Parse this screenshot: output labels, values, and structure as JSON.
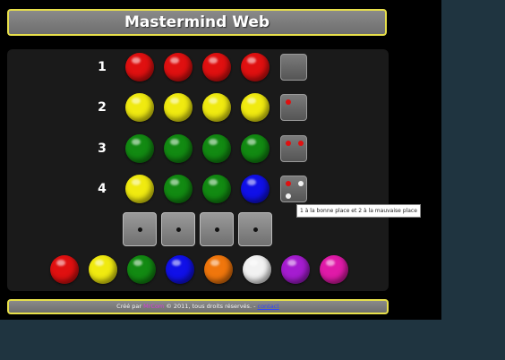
{
  "header": {
    "title": "Mastermind Web"
  },
  "rows": [
    {
      "number": "1",
      "pegs": [
        "red",
        "red",
        "red",
        "red"
      ],
      "feedback": []
    },
    {
      "number": "2",
      "pegs": [
        "yellow",
        "yellow",
        "yellow",
        "yellow"
      ],
      "feedback": [
        "red"
      ]
    },
    {
      "number": "3",
      "pegs": [
        "green",
        "green",
        "green",
        "green"
      ],
      "feedback": [
        "red",
        "red"
      ]
    },
    {
      "number": "4",
      "pegs": [
        "yellow",
        "green",
        "green",
        "blue"
      ],
      "feedback": [
        "red",
        "white",
        "white"
      ]
    }
  ],
  "tooltip": "1 à la bonne place et 2 à la mauvaise place",
  "palette": [
    "red",
    "yellow",
    "green",
    "blue",
    "orange",
    "white",
    "purple",
    "magenta"
  ],
  "colors": {
    "red": "#e01010",
    "yellow": "#f0ea10",
    "green": "#128a12",
    "blue": "#1010e8",
    "orange": "#f0760c",
    "white": "#f2f2f2",
    "purple": "#a51cd0",
    "magenta": "#e01aa8"
  },
  "footer": {
    "prefix": "Créé par ",
    "author": "MrCom",
    "middle": " © 2011, tous droits réservés. - ",
    "contact": "contact"
  }
}
